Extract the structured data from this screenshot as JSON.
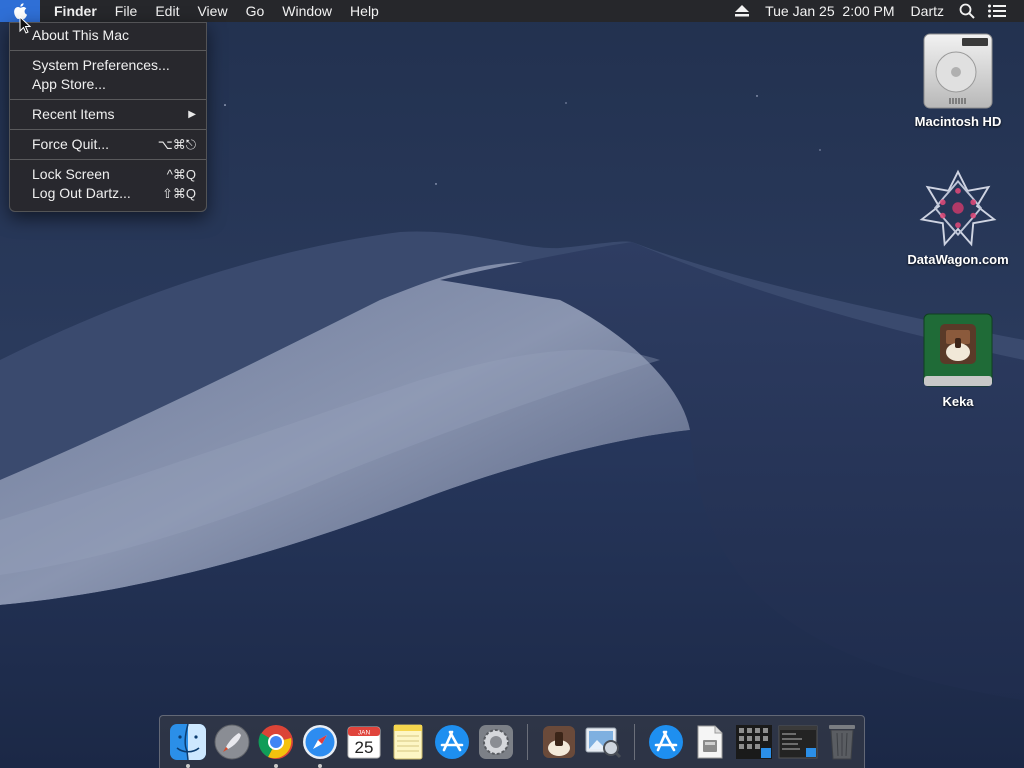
{
  "menubar": {
    "apple_icon": "apple-logo-icon",
    "app_name": "Finder",
    "menus": [
      "File",
      "Edit",
      "View",
      "Go",
      "Window",
      "Help"
    ],
    "eject_icon": "eject-icon",
    "clock": "Tue Jan 25  2:00 PM",
    "user": "Dartz",
    "search_icon": "spotlight-search-icon",
    "notifications_icon": "notification-center-icon"
  },
  "apple_menu": {
    "about": "About This Mac",
    "system_prefs": "System Preferences...",
    "app_store": "App Store...",
    "recent_items": "Recent Items",
    "recent_arrow": "▶",
    "force_quit": "Force Quit...",
    "force_quit_shortcut": "⌥⌘⎋",
    "lock_screen": "Lock Screen",
    "lock_screen_shortcut": "^⌘Q",
    "log_out": "Log Out Dartz...",
    "log_out_shortcut": "⇧⌘Q"
  },
  "desktop": {
    "icons": [
      {
        "name": "Macintosh HD",
        "icon": "hard-drive-icon"
      },
      {
        "name": "DataWagon.com",
        "icon": "network-server-icon"
      },
      {
        "name": "Keka",
        "icon": "keka-disk-image-icon"
      }
    ]
  },
  "dock": {
    "calendar_month": "JAN",
    "calendar_day": "25",
    "apps": [
      {
        "name": "Finder",
        "icon": "finder-icon",
        "running": true
      },
      {
        "name": "Launchpad",
        "icon": "launchpad-icon",
        "running": false
      },
      {
        "name": "Google Chrome",
        "icon": "chrome-icon",
        "running": true
      },
      {
        "name": "Safari",
        "icon": "safari-icon",
        "running": true
      },
      {
        "name": "Calendar",
        "icon": "calendar-icon",
        "running": false
      },
      {
        "name": "Notes",
        "icon": "notes-icon",
        "running": false
      },
      {
        "name": "App Store",
        "icon": "app-store-icon",
        "running": false
      },
      {
        "name": "System Preferences",
        "icon": "system-preferences-icon",
        "running": false
      },
      {
        "name": "Keka",
        "icon": "keka-icon",
        "running": false
      },
      {
        "name": "Preview",
        "icon": "preview-icon",
        "running": false
      },
      {
        "name": "App Store Folder",
        "icon": "app-store-folder-icon",
        "running": false
      },
      {
        "name": "Document",
        "icon": "document-icon",
        "running": false
      },
      {
        "name": "Screenshot Grid",
        "icon": "screenshot-grid-icon",
        "running": false
      },
      {
        "name": "Screenshot Window",
        "icon": "screenshot-window-icon",
        "running": false
      },
      {
        "name": "Trash",
        "icon": "trash-icon",
        "running": false
      }
    ]
  },
  "colors": {
    "menubar_bg": "#26262a",
    "menu_highlight": "#2f6fd6",
    "desktop_sky": "#1c2a4a"
  }
}
